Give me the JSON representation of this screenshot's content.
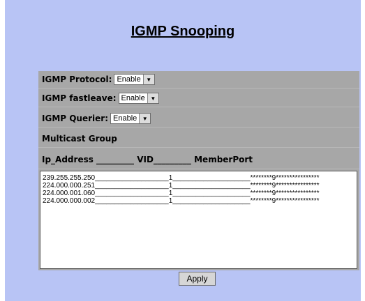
{
  "page": {
    "title": "IGMP Snooping"
  },
  "form": {
    "protocol": {
      "label": "IGMP Protocol:",
      "value": "Enable"
    },
    "fastleave": {
      "label": "IGMP fastleave:",
      "value": "Enable"
    },
    "querier": {
      "label": "IGMP Querier:",
      "value": "Enable"
    },
    "multicast_group_label": "Multicast Group",
    "column_header": "Ip_Address _________ VID_________ MemberPort"
  },
  "entries": [
    "239.255.255.250___________________1____________________********9****************",
    "224.000.000.251___________________1____________________********9****************",
    "224.000.001.060___________________1____________________********9****************",
    "224.000.000.002___________________1____________________********9****************"
  ],
  "buttons": {
    "apply": "Apply"
  }
}
